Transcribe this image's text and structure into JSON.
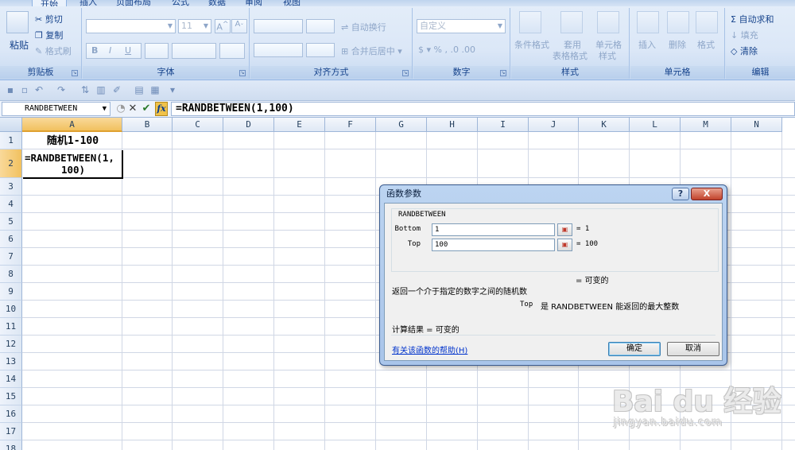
{
  "ribbon": {
    "tabs": [
      "开始",
      "插入",
      "页面布局",
      "公式",
      "数据",
      "审阅",
      "视图"
    ],
    "clipboard": {
      "paste": "粘贴",
      "cut": "剪切",
      "copy": "复制",
      "format_painter": "格式刷",
      "title": "剪贴板"
    },
    "font": {
      "size": "11",
      "bold": "B",
      "italic": "I",
      "underline": "U",
      "title": "字体"
    },
    "alignment": {
      "wrap": "自动换行",
      "merge": "合并后居中",
      "title": "对齐方式"
    },
    "number": {
      "format": "自定义",
      "title": "数字"
    },
    "styles": {
      "conditional": "条件格式",
      "table_format_1": "套用",
      "table_format_2": "表格格式",
      "cell_styles_1": "单元格",
      "cell_styles_2": "样式",
      "title": "样式"
    },
    "cells": {
      "insert": "插入",
      "delete": "删除",
      "format": "格式",
      "title": "单元格"
    },
    "editing": {
      "autosum": "自动求和",
      "fill": "填充",
      "clear": "清除",
      "title": "编辑"
    }
  },
  "formula_bar": {
    "name_box": "RANDBETWEEN",
    "fx": "fx",
    "formula": "=RANDBETWEEN(1,100)"
  },
  "columns": [
    "A",
    "B",
    "C",
    "D",
    "E",
    "F",
    "G",
    "H",
    "I",
    "J",
    "K",
    "L",
    "M",
    "N"
  ],
  "rows": [
    "1",
    "2",
    "3",
    "4",
    "5",
    "6",
    "7",
    "8",
    "9",
    "10",
    "11",
    "12",
    "13",
    "14",
    "15",
    "16",
    "17",
    "18"
  ],
  "cells": {
    "A1": "随机1-100",
    "A2_line1": "=RANDBETWEEN(1,",
    "A2_line2": "100)"
  },
  "dialog": {
    "title": "函数参数",
    "help_btn": "?",
    "close_btn": "X",
    "function_name": "RANDBETWEEN",
    "args": [
      {
        "label": "Bottom",
        "value": "1",
        "result": "= 1"
      },
      {
        "label": "Top",
        "value": "100",
        "result": "= 100"
      }
    ],
    "formula_result_inline": "= 可变的",
    "description": "返回一个介于指定的数字之间的随机数",
    "arg_help_name": "Top",
    "arg_help_text": "是 RANDBETWEEN 能返回的最大整数",
    "calc_result": "计算结果 = 可变的",
    "help_link": "有关该函数的帮助(H)",
    "ok": "确定",
    "cancel": "取消"
  },
  "watermark": {
    "logo": "Bai du 经验",
    "url": "jingyan.baidu.com"
  }
}
